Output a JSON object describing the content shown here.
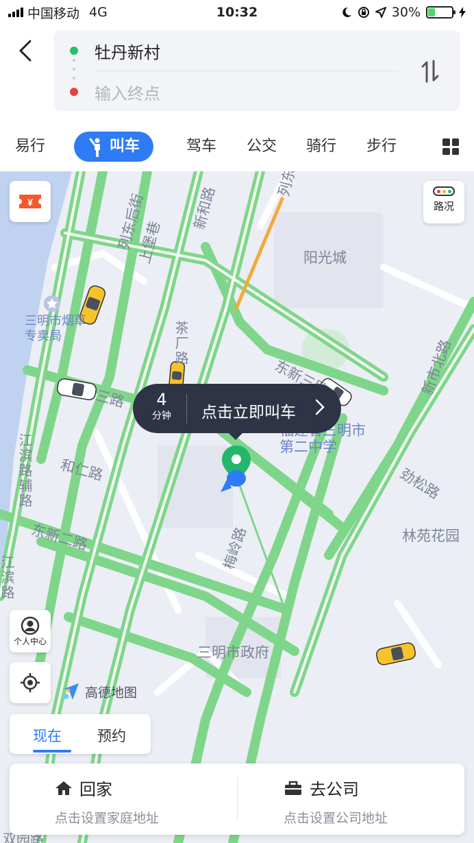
{
  "status_bar": {
    "carrier": "中国移动",
    "network": "4G",
    "time": "10:32",
    "battery": "30%",
    "battery_level": 0.3
  },
  "route": {
    "start": "牡丹新村",
    "end_placeholder": "输入终点"
  },
  "tabs": [
    {
      "label": "易行"
    },
    {
      "label": "叫车",
      "active": true
    },
    {
      "label": "驾车"
    },
    {
      "label": "公交"
    },
    {
      "label": "骑行"
    },
    {
      "label": "步行"
    }
  ],
  "map": {
    "traffic_label": "路况",
    "labels": {
      "liedonghoujie": "列东后街",
      "shibaoxiang": "上堡巷",
      "xinhelu": "新和路",
      "liedongjie": "列东街",
      "yangguangcheng": "阳光城",
      "yancaoju": "三明市烟草专卖局",
      "chachanglu": "茶厂路",
      "dongxinsanlu": "东新三路",
      "xinshibeilu": "新市北路",
      "sanlu": "三路",
      "school": "福建省三明市第二中学",
      "jiangbinfulu": "江滨路辅路",
      "herenlu": "和仁路",
      "jinsonglu": "劲松路",
      "linyuanhuayuan": "林苑花园",
      "meilinglu": "梅岭路",
      "dongxinerlu": "东新二路",
      "jiangbinlu": "江滨路",
      "government": "三明市政府",
      "shuangyuanlu": "双园路"
    },
    "brand": "高德地图"
  },
  "call_bubble": {
    "minutes": "4",
    "unit": "分钟",
    "action": "点击立即叫车"
  },
  "controls": {
    "user_center": "个人中心"
  },
  "time_mode": {
    "now": "现在",
    "reserve": "预约"
  },
  "quick_dest": {
    "home_title": "回家",
    "home_sub": "点击设置家庭地址",
    "work_title": "去公司",
    "work_sub": "点击设置公司地址"
  },
  "colors": {
    "accent": "#2f7bf5",
    "road_green": "#7fd68a",
    "start_dot": "#1ec26b",
    "end_dot": "#e8413c",
    "bubble": "#2e3446"
  }
}
